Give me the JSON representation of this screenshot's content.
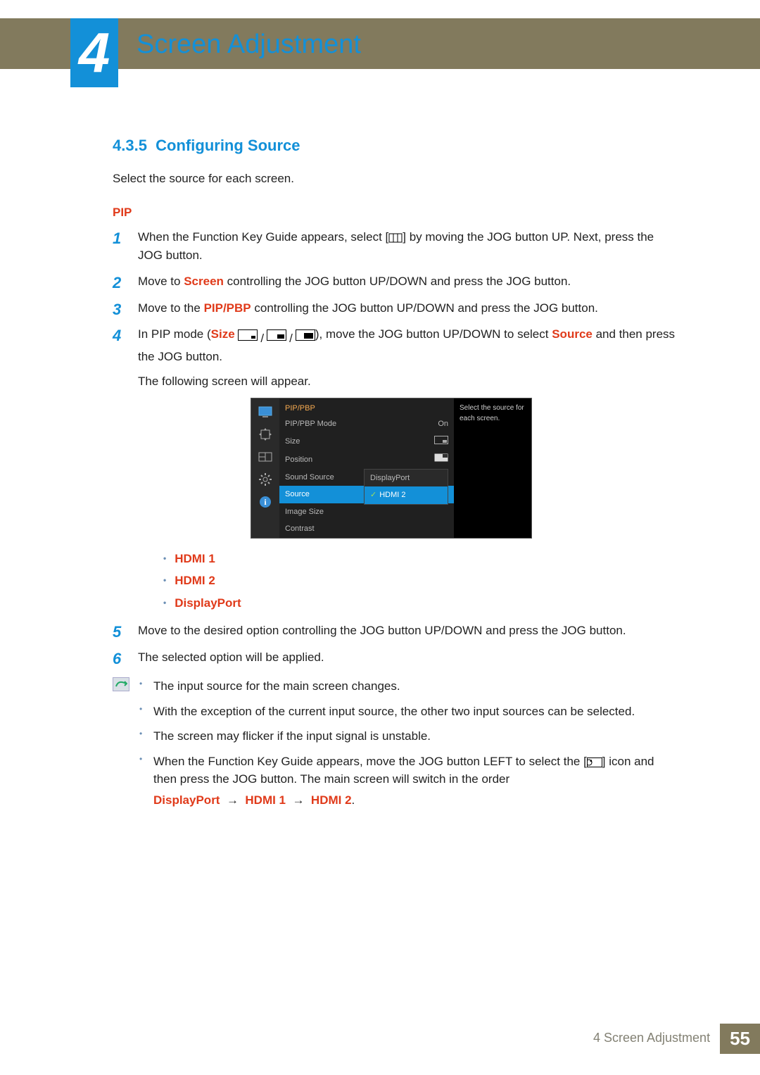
{
  "chapter": {
    "number": "4",
    "title": "Screen Adjustment"
  },
  "section": {
    "number": "4.3.5",
    "heading": "Configuring Source",
    "intro": "Select the source for each screen.",
    "sublabel": "PIP"
  },
  "steps": {
    "s1a": "When the Function Key Guide appears, select [",
    "s1b": "] by moving the JOG button UP. Next, press the JOG button.",
    "s2a": "Move to ",
    "s2k": "Screen",
    "s2b": " controlling the JOG button UP/DOWN and press the JOG button.",
    "s3a": "Move to the ",
    "s3k": "PIP/PBP",
    "s3b": " controlling the JOG button UP/DOWN and press the JOG button.",
    "s4a": "In PIP mode (",
    "s4size": "Size",
    "s4b": "), move the JOG button UP/DOWN to select ",
    "s4src": "Source",
    "s4c": " and then press the JOG button.",
    "s4d": "The following screen will appear.",
    "s5": "Move to the desired option controlling the JOG button UP/DOWN and press the JOG button.",
    "s6": "The selected option will be applied."
  },
  "osd": {
    "title": "PIP/PBP",
    "rows": {
      "mode": "PIP/PBP Mode",
      "mode_val": "On",
      "size": "Size",
      "position": "Position",
      "sound": "Sound Source",
      "source": "Source",
      "imgsize": "Image Size",
      "contrast": "Contrast"
    },
    "dropdown": {
      "dp": "DisplayPort",
      "hdmi2": "HDMI 2"
    },
    "hint": "Select the source for each screen."
  },
  "source_options": {
    "a": "HDMI 1",
    "b": "HDMI 2",
    "c": "DisplayPort"
  },
  "notes": {
    "n1": "The input source for the main screen changes.",
    "n2": "With the exception of the current input source, the other two input sources can be selected.",
    "n3": "The screen may flicker if the input signal is unstable.",
    "n4a": "When the Function Key Guide appears, move the JOG button LEFT to select the [",
    "n4b": "] icon and then press the JOG button. The main screen will switch in the order",
    "seq_a": "DisplayPort",
    "seq_b": "HDMI 1",
    "seq_c": "HDMI 2"
  },
  "footer": {
    "label": "4 Screen Adjustment",
    "page": "55"
  }
}
